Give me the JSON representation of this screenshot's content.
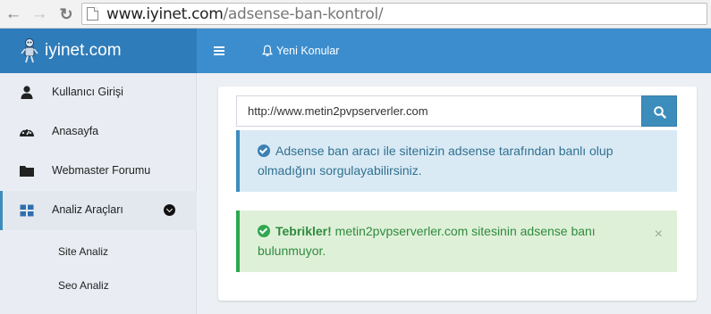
{
  "browser": {
    "url_domain": "www.iyinet.com",
    "url_path": "/adsense-ban-kontrol/"
  },
  "brand": {
    "name": "iyinet.com"
  },
  "topnav": {
    "new_topics": "Yeni Konular"
  },
  "sidebar": {
    "items": [
      {
        "label": "Kullanıcı Girişi",
        "icon": "user-icon"
      },
      {
        "label": "Anasayfa",
        "icon": "dashboard-icon"
      },
      {
        "label": "Webmaster Forumu",
        "icon": "folder-icon"
      },
      {
        "label": "Analiz Araçları",
        "icon": "grid-icon"
      }
    ],
    "subitems": [
      {
        "label": "Site Analiz"
      },
      {
        "label": "Seo Analiz"
      }
    ]
  },
  "search": {
    "value": "http://www.metin2pvpserverler.com",
    "button_icon": "search-icon"
  },
  "alerts": {
    "info": {
      "text": "Adsense ban aracı ile sitenizin adsense tarafından banlı olup olmadığını sorgulayabilirsiniz."
    },
    "success": {
      "strong": "Tebrikler!",
      "text": " metin2pvpserverler.com sitesinin adsense banı bulunmuyor.",
      "close": "×"
    }
  },
  "colors": {
    "brand": "#2f7cba",
    "topbar": "#3c8dcd",
    "info": "#31708f",
    "success": "#2e8b3e"
  }
}
